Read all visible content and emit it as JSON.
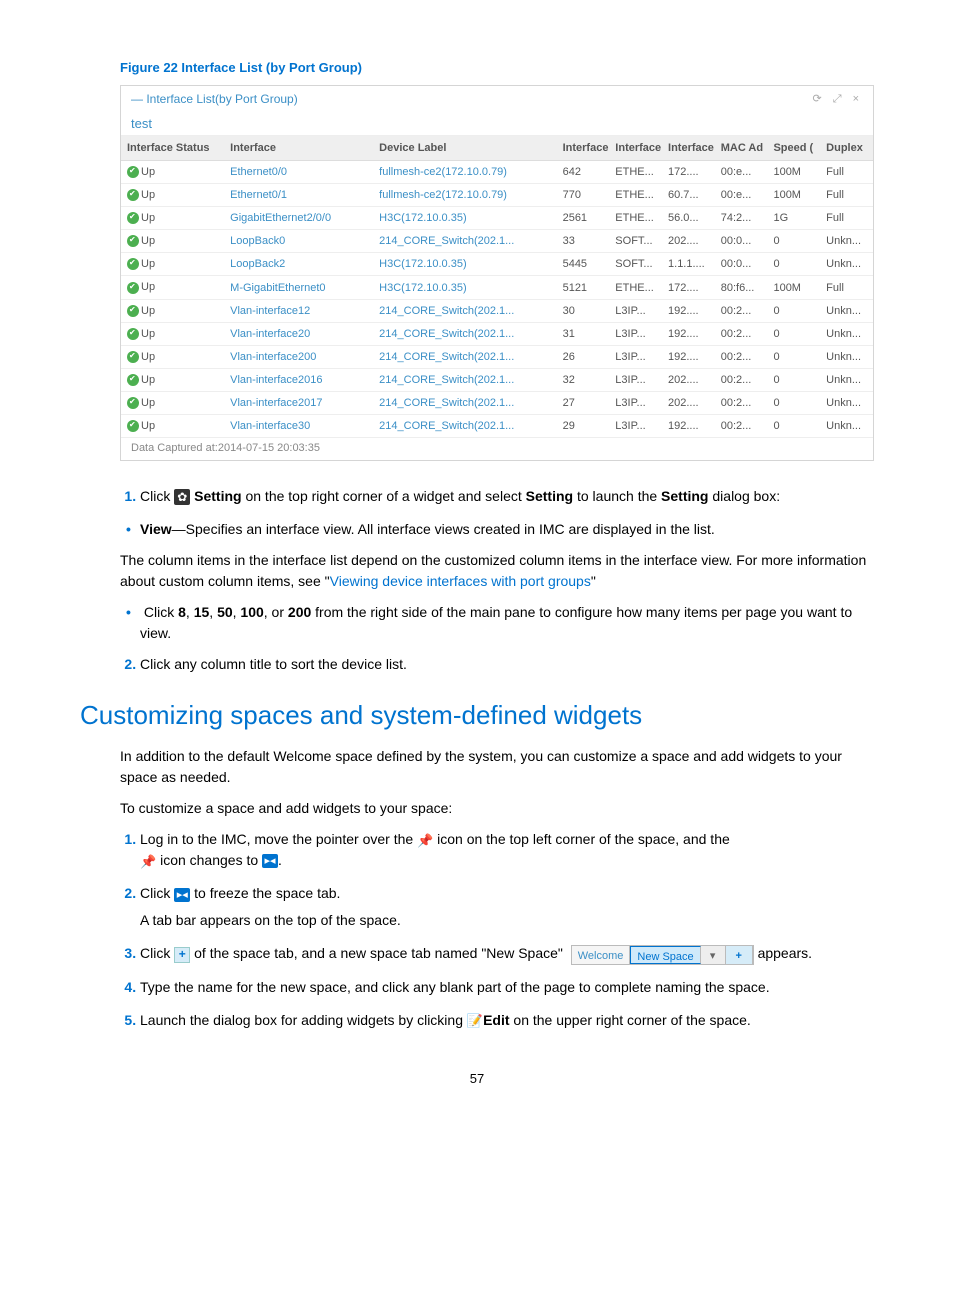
{
  "figure": {
    "caption": "Figure 22 Interface List (by Port Group)",
    "widget_title": "— Interface List(by Port Group)",
    "subtitle": "test",
    "capture_label": "Data Captured at:2014-07-15 20:03:35"
  },
  "table": {
    "headers": [
      "Interface Status",
      "Interface",
      "Device Label",
      "Interface",
      "Interface",
      "Interface",
      "MAC Ad",
      "Speed (",
      "Duplex "
    ],
    "rows": [
      {
        "status": "Up",
        "iface": "Ethernet0/0",
        "label": "fullmesh-ce2(172.10.0.79)",
        "c1": "642",
        "c2": "ETHE...",
        "c3": "172....",
        "c4": "00:e...",
        "c5": "100M",
        "c6": "Full"
      },
      {
        "status": "Up",
        "iface": "Ethernet0/1",
        "label": "fullmesh-ce2(172.10.0.79)",
        "c1": "770",
        "c2": "ETHE...",
        "c3": "60.7...",
        "c4": "00:e...",
        "c5": "100M",
        "c6": "Full"
      },
      {
        "status": "Up",
        "iface": "GigabitEthernet2/0/0",
        "label": "H3C(172.10.0.35)",
        "c1": "2561",
        "c2": "ETHE...",
        "c3": "56.0...",
        "c4": "74:2...",
        "c5": "1G",
        "c6": "Full"
      },
      {
        "status": "Up",
        "iface": "LoopBack0",
        "label": "214_CORE_Switch(202.1...",
        "c1": "33",
        "c2": "SOFT...",
        "c3": "202....",
        "c4": "00:0...",
        "c5": "0",
        "c6": "Unkn..."
      },
      {
        "status": "Up",
        "iface": "LoopBack2",
        "label": "H3C(172.10.0.35)",
        "c1": "5445",
        "c2": "SOFT...",
        "c3": "1.1.1....",
        "c4": "00:0...",
        "c5": "0",
        "c6": "Unkn..."
      },
      {
        "status": "Up",
        "iface": "M-GigabitEthernet0",
        "label": "H3C(172.10.0.35)",
        "c1": "5121",
        "c2": "ETHE...",
        "c3": "172....",
        "c4": "80:f6...",
        "c5": "100M",
        "c6": "Full"
      },
      {
        "status": "Up",
        "iface": "Vlan-interface12",
        "label": "214_CORE_Switch(202.1...",
        "c1": "30",
        "c2": "L3IP...",
        "c3": "192....",
        "c4": "00:2...",
        "c5": "0",
        "c6": "Unkn..."
      },
      {
        "status": "Up",
        "iface": "Vlan-interface20",
        "label": "214_CORE_Switch(202.1...",
        "c1": "31",
        "c2": "L3IP...",
        "c3": "192....",
        "c4": "00:2...",
        "c5": "0",
        "c6": "Unkn..."
      },
      {
        "status": "Up",
        "iface": "Vlan-interface200",
        "label": "214_CORE_Switch(202.1...",
        "c1": "26",
        "c2": "L3IP...",
        "c3": "192....",
        "c4": "00:2...",
        "c5": "0",
        "c6": "Unkn..."
      },
      {
        "status": "Up",
        "iface": "Vlan-interface2016",
        "label": "214_CORE_Switch(202.1...",
        "c1": "32",
        "c2": "L3IP...",
        "c3": "202....",
        "c4": "00:2...",
        "c5": "0",
        "c6": "Unkn..."
      },
      {
        "status": "Up",
        "iface": "Vlan-interface2017",
        "label": "214_CORE_Switch(202.1...",
        "c1": "27",
        "c2": "L3IP...",
        "c3": "202....",
        "c4": "00:2...",
        "c5": "0",
        "c6": "Unkn..."
      },
      {
        "status": "Up",
        "iface": "Vlan-interface30",
        "label": "214_CORE_Switch(202.1...",
        "c1": "29",
        "c2": "L3IP...",
        "c3": "192....",
        "c4": "00:2...",
        "c5": "0",
        "c6": "Unkn..."
      }
    ]
  },
  "instr": {
    "step1_a": "Click ",
    "step1_b": " Setting",
    "step1_c": " on the top right corner of a widget and select ",
    "step1_d": "Setting",
    "step1_e": " to launch the ",
    "step1_f": "Setting",
    "step1_g": " dialog box:",
    "bullet_view_a": "View",
    "bullet_view_b": "—Specifies an interface view. All interface views created in IMC are displayed in the list.",
    "para1_a": "The column items in the interface list depend on the customized column items in the interface view. For more information about custom column items, see \"",
    "para1_link": "Viewing device interfaces with port groups",
    "para1_b": "\"",
    "bullet_pg_a": "Click ",
    "bullet_pg_b": "8",
    "bullet_pg_c": ", ",
    "bullet_pg_d": "15",
    "bullet_pg_e": ", ",
    "bullet_pg_f": "50",
    "bullet_pg_g": ", ",
    "bullet_pg_h": "100",
    "bullet_pg_i": ", or ",
    "bullet_pg_j": "200",
    "bullet_pg_k": " from the right side of the main pane to configure how many items per page you want to view.",
    "step2": "Click any column title to sort the device list."
  },
  "section_title": "Customizing spaces and system-defined widgets",
  "custom": {
    "intro": "In addition to the default Welcome space defined by the system, you can customize a space and add widgets to your space as needed.",
    "lead": "To customize a space and add widgets to your space:",
    "s1a": "Log in to the IMC, move the pointer over the ",
    "s1b": " icon on the top left corner of the space, and the ",
    "s1c": " icon changes to ",
    "s1d": ".",
    "s2a": "Click ",
    "s2b": " to freeze the space tab.",
    "s2sub": "A tab bar appears on the top of the space.",
    "s3a": "Click ",
    "s3b": " of the space tab, and a new space tab named \"New Space\" ",
    "s3c": " appears.",
    "s4": "Type the name for the new space, and click any blank part of the page to complete naming the space.",
    "s5a": "Launch the dialog box for adding widgets by clicking ",
    "s5b": "Edit",
    "s5c": " on the upper right corner of the space."
  },
  "tabs": {
    "welcome": "Welcome",
    "newspace": "New Space",
    "drop": "▾",
    "plus": "+"
  },
  "page_number": "57"
}
